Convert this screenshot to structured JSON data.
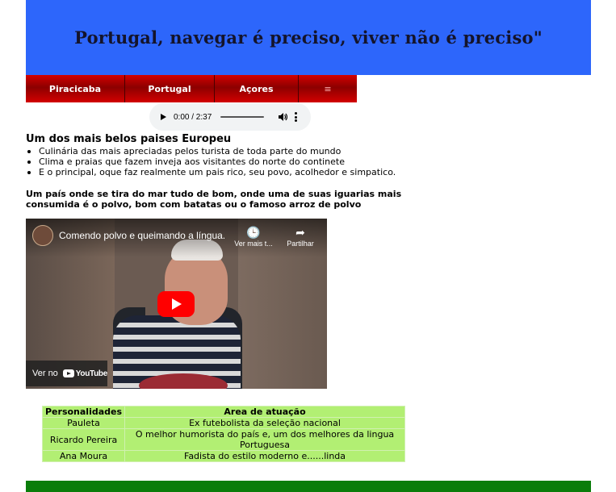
{
  "header": {
    "title": "Portugal, navegar é preciso, viver não é preciso\""
  },
  "nav": {
    "items": [
      {
        "label": "Piracicaba"
      },
      {
        "label": "Portugal"
      },
      {
        "label": "Açores"
      },
      {
        "label": "≡"
      }
    ]
  },
  "audio": {
    "time": "0:00 / 2:37",
    "progress": 0
  },
  "content": {
    "title": "Um dos mais belos paises Europeu",
    "features": [
      "Culinária das mais apreciadas pelos turista de toda parte do mundo",
      "Clima e praias que fazem inveja aos visitantes do norte do continete",
      "E o principal, oque faz realmente um pais rico, seu povo, acolhedor e simpatico."
    ],
    "paragraph": "Um país onde se tira do mar tudo de bom, onde uma de suas iguarias mais consumida é o polvo, bom com batatas ou o famoso arroz de polvo"
  },
  "video": {
    "title": "Comendo polvo e queimando a língua.",
    "watch_later": "Ver mais t...",
    "share": "Partilhar",
    "watch_on": "Ver no",
    "brand": "YouTube"
  },
  "table": {
    "headers": [
      "Personalidades",
      "Area de atuação"
    ],
    "rows": [
      [
        "Pauleta",
        "Ex futebolista da seleção nacional"
      ],
      [
        "Ricardo Pereira",
        "O melhor humorista do país e, um dos melhores da lingua Portuguesa"
      ],
      [
        "Ana Moura",
        "Fadista do estilo moderno e......linda"
      ]
    ]
  },
  "colors": {
    "header_bg": "#2d66fb",
    "nav_bg": "#b00000",
    "table_bg": "#b2ef73",
    "footer_bg": "#0a7d0a"
  }
}
